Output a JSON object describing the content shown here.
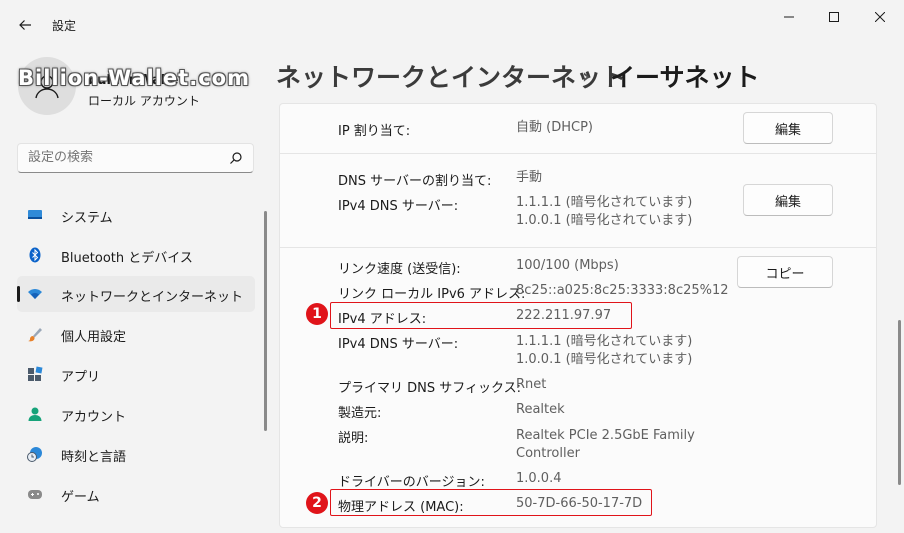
{
  "app": {
    "title": "設定"
  },
  "watermark": "Billion-Wallet.com",
  "user": {
    "name": "bullionWallet",
    "type": "ローカル アカウント"
  },
  "search": {
    "placeholder": "設定の検索"
  },
  "nav": [
    {
      "label": "システム",
      "icon": "monitor-icon",
      "color": "#0078d4"
    },
    {
      "label": "Bluetooth とデバイス",
      "icon": "bluetooth-icon",
      "color": "#0a62c9"
    },
    {
      "label": "ネットワークとインターネット",
      "icon": "wifi-icon",
      "color": "#2b88d8",
      "active": true
    },
    {
      "label": "個人用設定",
      "icon": "brush-icon",
      "color": "#e8812a"
    },
    {
      "label": "アプリ",
      "icon": "apps-icon",
      "color": "#4b5a6b"
    },
    {
      "label": "アカウント",
      "icon": "person-icon",
      "color": "#17a37a"
    },
    {
      "label": "時刻と言語",
      "icon": "clock-globe-icon",
      "color": "#2b88d8"
    },
    {
      "label": "ゲーム",
      "icon": "gamepad-icon",
      "color": "#7a7a7a"
    }
  ],
  "breadcrumb": {
    "parent": "ネットワークとインターネット",
    "separator": "›",
    "current": "イーサネット"
  },
  "ip_assignment": {
    "label": "IP 割り当て:",
    "value": "自動 (DHCP)",
    "button": "編集"
  },
  "dns_assignment": {
    "label": "DNS サーバーの割り当て:",
    "value": "手動",
    "ipv4_dns_label": "IPv4 DNS サーバー:",
    "ipv4_dns_values": [
      "1.1.1.1 (暗号化されています)",
      "1.0.0.1 (暗号化されています)"
    ],
    "button": "編集"
  },
  "properties": {
    "copy_button": "コピー",
    "rows": {
      "link_speed": {
        "label": "リンク速度 (送受信):",
        "value": "100/100 (Mbps)"
      },
      "ipv6_link_local": {
        "label": "リンク ローカル IPv6 アドレス:",
        "value": "8c25::a025:8c25:3333:8c25%12"
      },
      "ipv4_address": {
        "label": "IPv4 アドレス:",
        "value": "222.211.97.97"
      },
      "ipv4_dns": {
        "label": "IPv4 DNS サーバー:",
        "value1": "1.1.1.1 (暗号化されています)",
        "value2": "1.0.0.1 (暗号化されています)"
      },
      "dns_suffix": {
        "label": "プライマリ DNS サフィックス:",
        "value": "Rnet"
      },
      "manufacturer": {
        "label": "製造元:",
        "value": "Realtek"
      },
      "description": {
        "label": "説明:",
        "value1": "Realtek PCIe 2.5GbE Family",
        "value2": "Controller"
      },
      "driver_version": {
        "label": "ドライバーのバージョン:",
        "value": "1.0.0.4"
      },
      "mac_address": {
        "label": "物理アドレス (MAC):",
        "value": "50-7D-66-50-17-7D"
      }
    }
  },
  "markers": [
    "1",
    "2"
  ],
  "accent": "#e0141a"
}
